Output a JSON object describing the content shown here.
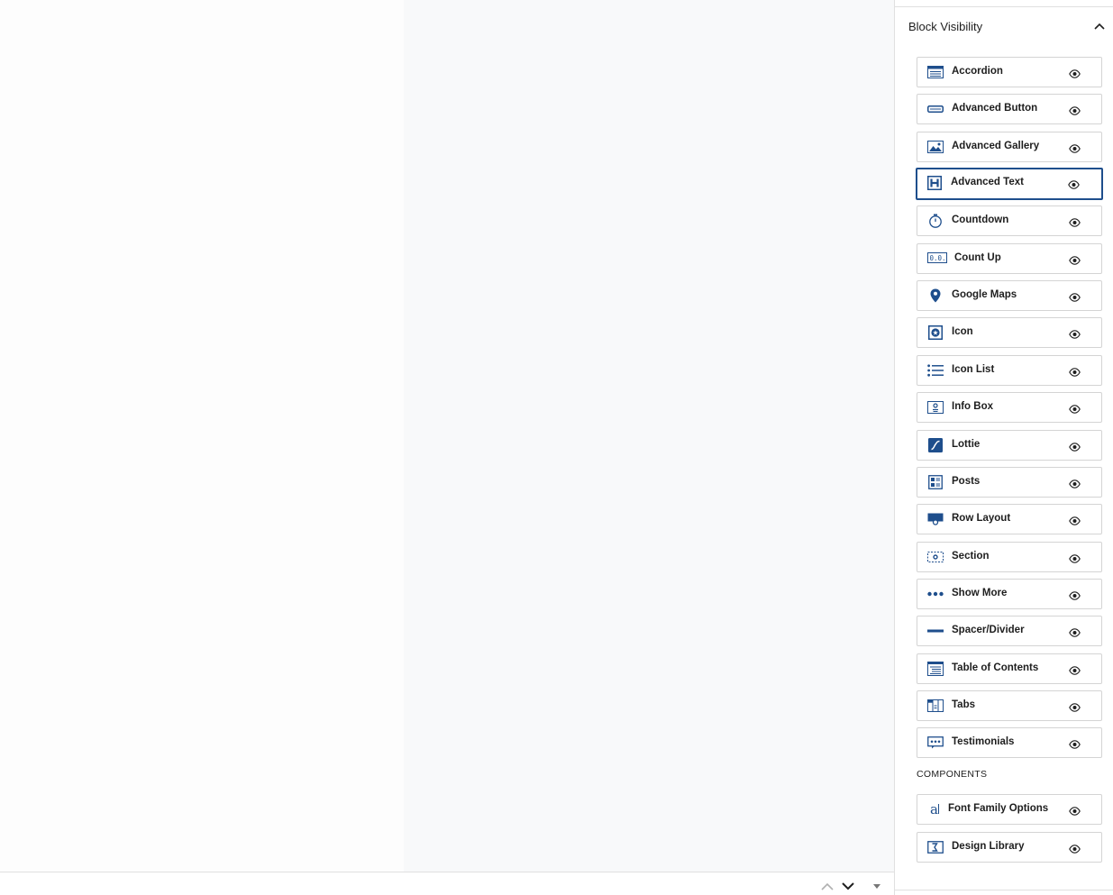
{
  "panel": {
    "title": "Block Visibility",
    "toggle_icon": "chevron-up-icon"
  },
  "blocks": [
    {
      "label": "Accordion",
      "icon": "accordion-icon",
      "visible": true
    },
    {
      "label": "Advanced Button",
      "icon": "button-icon",
      "visible": true
    },
    {
      "label": "Advanced Gallery",
      "icon": "gallery-icon",
      "visible": true
    },
    {
      "label": "Advanced Text",
      "icon": "heading-icon",
      "visible": true,
      "focused": true
    },
    {
      "label": "Countdown",
      "icon": "stopwatch-icon",
      "visible": true
    },
    {
      "label": "Count Up",
      "icon": "counter-icon",
      "visible": true
    },
    {
      "label": "Google Maps",
      "icon": "map-pin-icon",
      "visible": true
    },
    {
      "label": "Icon",
      "icon": "star-icon",
      "visible": true
    },
    {
      "label": "Icon List",
      "icon": "list-icon",
      "visible": true
    },
    {
      "label": "Info Box",
      "icon": "info-box-icon",
      "visible": true
    },
    {
      "label": "Lottie",
      "icon": "lottie-icon",
      "visible": true
    },
    {
      "label": "Posts",
      "icon": "posts-icon",
      "visible": true
    },
    {
      "label": "Row Layout",
      "icon": "row-layout-icon",
      "visible": true
    },
    {
      "label": "Section",
      "icon": "section-icon",
      "visible": true
    },
    {
      "label": "Show More",
      "icon": "ellipsis-icon",
      "visible": true
    },
    {
      "label": "Spacer/Divider",
      "icon": "divider-icon",
      "visible": true
    },
    {
      "label": "Table of Contents",
      "icon": "toc-icon",
      "visible": true
    },
    {
      "label": "Tabs",
      "icon": "tabs-icon",
      "visible": true
    },
    {
      "label": "Testimonials",
      "icon": "testimonials-icon",
      "visible": true
    }
  ],
  "components_label": "COMPONENTS",
  "components": [
    {
      "label": "Font Family Options",
      "icon": "font-icon",
      "visible": true
    },
    {
      "label": "Design Library",
      "icon": "design-library-icon",
      "visible": true
    }
  ],
  "colors": {
    "accent": "#1e4e8c",
    "border": "#d4d4d4",
    "focus_border": "#1e4e8c"
  },
  "footer": {
    "controls": [
      "chevron-up-icon",
      "chevron-down-icon",
      "caret-down-icon"
    ]
  }
}
